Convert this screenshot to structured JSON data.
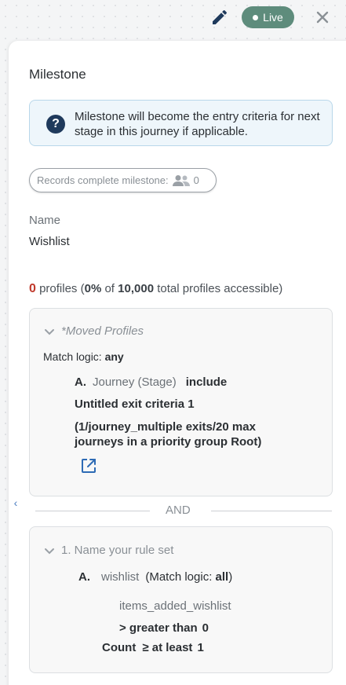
{
  "header": {
    "edit_icon": "pencil-icon",
    "status_label": "Live",
    "close_icon": "close-icon"
  },
  "panel": {
    "title": "Milestone",
    "info": {
      "icon": "question-circle-icon",
      "text": "Milestone will become the entry criteria for next stage in this journey if applicable."
    },
    "records_pill": {
      "label": "Records complete milestone:",
      "icon": "people-icon",
      "count": "0"
    },
    "name_label": "Name",
    "name_value": "Wishlist",
    "profiles": {
      "count": "0",
      "word": "profiles (",
      "percent": "0%",
      "of": "of",
      "total": "10,000",
      "suffix": "total profiles accessible)"
    },
    "moved_profiles": {
      "title": "*Moved Profiles",
      "match_prefix": "Match logic:",
      "match_value": "any",
      "rule_letter": "A.",
      "rule_source": "Journey (Stage)",
      "rule_op": "include",
      "exit_name": "Untitled exit criteria 1",
      "journey_text": "(1/journey_multiple exits/20 max journeys in a priority group Root)",
      "link_icon": "external-link-icon"
    },
    "separator": "AND",
    "rule_set": {
      "title": "1.  Name your rule set",
      "rule_letter": "A.",
      "rule_source": "wishlist",
      "match_prefix": "(Match logic:",
      "match_value": "all",
      "match_suffix": ")",
      "event_name": "items_added_wishlist",
      "condition_op": "> greater than",
      "condition_value": "0",
      "count_label": "Count",
      "count_op": "≥ at least",
      "count_value": "1"
    }
  },
  "colors": {
    "live_badge": "#5e8c7c",
    "info_bg": "#eef6fb",
    "info_border": "#b8d7ea",
    "info_icon": "#1f3a5c",
    "accent_red": "#c0392b",
    "link_blue": "#2e6bb5"
  }
}
